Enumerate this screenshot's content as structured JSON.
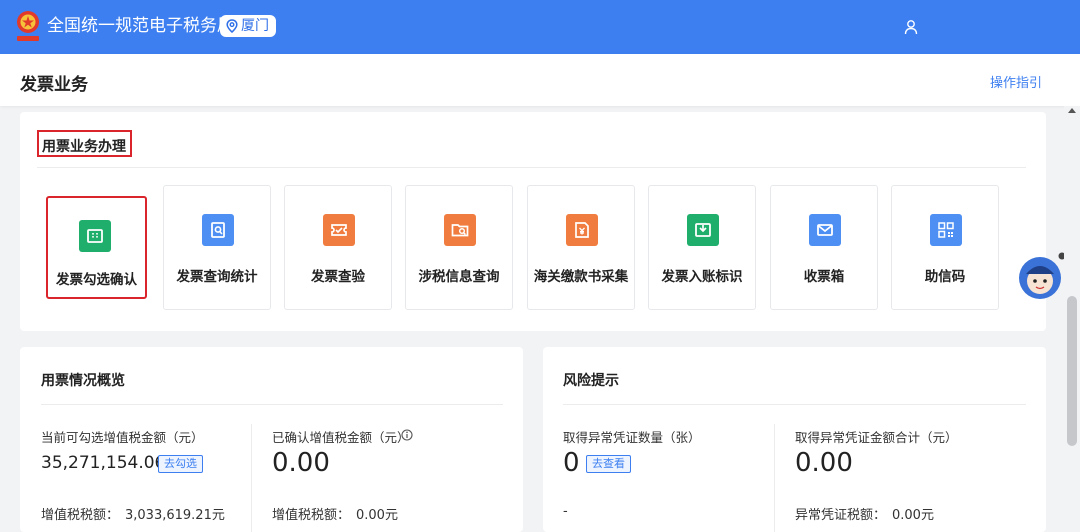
{
  "header": {
    "title": "全国统一规范电子税务局",
    "region": "厦门"
  },
  "page": {
    "title": "发票业务",
    "guide_link": "操作指引"
  },
  "business": {
    "section_title": "用票业务办理",
    "tiles": [
      {
        "label": "发票勾选确认",
        "icon": "ticket-icon",
        "color": "#1fae6b"
      },
      {
        "label": "发票查询统计",
        "icon": "search-document-icon",
        "color": "#4d8ff2"
      },
      {
        "label": "发票查验",
        "icon": "ticket-check-icon",
        "color": "#f07d3f"
      },
      {
        "label": "涉税信息查询",
        "icon": "folder-search-icon",
        "color": "#f07d3f"
      },
      {
        "label": "海关缴款书采集",
        "icon": "document-yuan-icon",
        "color": "#f07d3f"
      },
      {
        "label": "发票入账标识",
        "icon": "box-download-icon",
        "color": "#1fae6b"
      },
      {
        "label": "收票箱",
        "icon": "mail-icon",
        "color": "#4d8ff2"
      },
      {
        "label": "助信码",
        "icon": "qr-code-icon",
        "color": "#4d8ff2"
      }
    ]
  },
  "overview": {
    "title": "用票情况概览",
    "left": {
      "label": "当前可勾选增值税金额（元）",
      "value": "35,271,154.06",
      "action": "去勾选",
      "sub_label": "增值税税额：",
      "sub_value": "3,033,619.21元"
    },
    "right": {
      "label": "已确认增值税金额（元）",
      "value": "0.00",
      "sub_label": "增值税税额：",
      "sub_value": "0.00元"
    }
  },
  "risk": {
    "title": "风险提示",
    "left": {
      "label": "取得异常凭证数量（张）",
      "value": "0",
      "action": "去查看",
      "sub_value": "-"
    },
    "right": {
      "label": "取得异常凭证金额合计（元）",
      "value": "0.00",
      "sub_label": "异常凭证税额：",
      "sub_value": "0.00元"
    }
  },
  "floating": {
    "icon": "customer-service-avatar-icon"
  },
  "colors": {
    "topbar": "#3d7ff0",
    "highlight": "#d9252b",
    "link": "#3d7ff0"
  }
}
